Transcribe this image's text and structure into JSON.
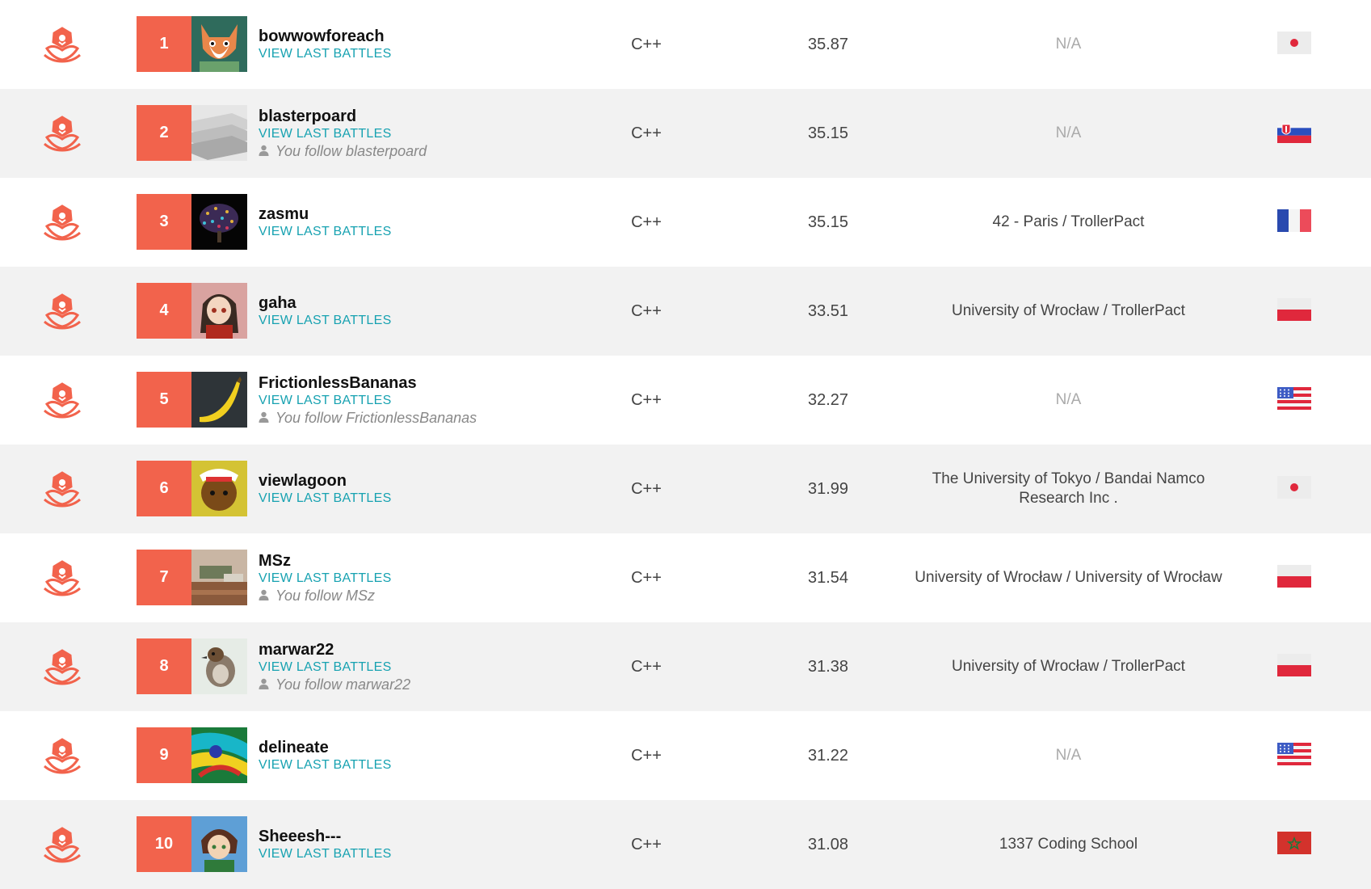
{
  "colors": {
    "accent": "#f2634c",
    "link": "#17a2b1",
    "row_alt": "#f2f2f2"
  },
  "follow_icon": "person-icon",
  "rows": [
    {
      "rank": "1",
      "username": "bowwowforeach",
      "battles": "VIEW LAST BATTLES",
      "follow": "",
      "language": "C++",
      "score": "35.87",
      "company": "N/A",
      "flag": "japan-flag"
    },
    {
      "rank": "2",
      "username": "blasterpoard",
      "battles": "VIEW LAST BATTLES",
      "follow": "You follow blasterpoard",
      "language": "C++",
      "score": "35.15",
      "company": "N/A",
      "flag": "slovakia-flag"
    },
    {
      "rank": "3",
      "username": "zasmu",
      "battles": "VIEW LAST BATTLES",
      "follow": "",
      "language": "C++",
      "score": "35.15",
      "company": "42 - Paris / TrollerPact",
      "flag": "france-flag"
    },
    {
      "rank": "4",
      "username": "gaha",
      "battles": "VIEW LAST BATTLES",
      "follow": "",
      "language": "C++",
      "score": "33.51",
      "company": "University of Wrocław / TrollerPact",
      "flag": "poland-flag"
    },
    {
      "rank": "5",
      "username": "FrictionlessBananas",
      "battles": "VIEW LAST BATTLES",
      "follow": "You follow FrictionlessBananas",
      "language": "C++",
      "score": "32.27",
      "company": "N/A",
      "flag": "usa-flag"
    },
    {
      "rank": "6",
      "username": "viewlagoon",
      "battles": "VIEW LAST BATTLES",
      "follow": "",
      "language": "C++",
      "score": "31.99",
      "company": "The University of Tokyo / Bandai Namco Research Inc .",
      "flag": "japan-flag"
    },
    {
      "rank": "7",
      "username": "MSz",
      "battles": "VIEW LAST BATTLES",
      "follow": "You follow MSz",
      "language": "C++",
      "score": "31.54",
      "company": "University of Wrocław / University of Wrocław",
      "flag": "poland-flag"
    },
    {
      "rank": "8",
      "username": "marwar22",
      "battles": "VIEW LAST BATTLES",
      "follow": "You follow marwar22",
      "language": "C++",
      "score": "31.38",
      "company": "University of Wrocław / TrollerPact",
      "flag": "poland-flag"
    },
    {
      "rank": "9",
      "username": "delineate",
      "battles": "VIEW LAST BATTLES",
      "follow": "",
      "language": "C++",
      "score": "31.22",
      "company": "N/A",
      "flag": "usa-flag"
    },
    {
      "rank": "10",
      "username": "Sheeesh---",
      "battles": "VIEW LAST BATTLES",
      "follow": "",
      "language": "C++",
      "score": "31.08",
      "company": "1337 Coding School",
      "flag": "morocco-flag"
    }
  ]
}
